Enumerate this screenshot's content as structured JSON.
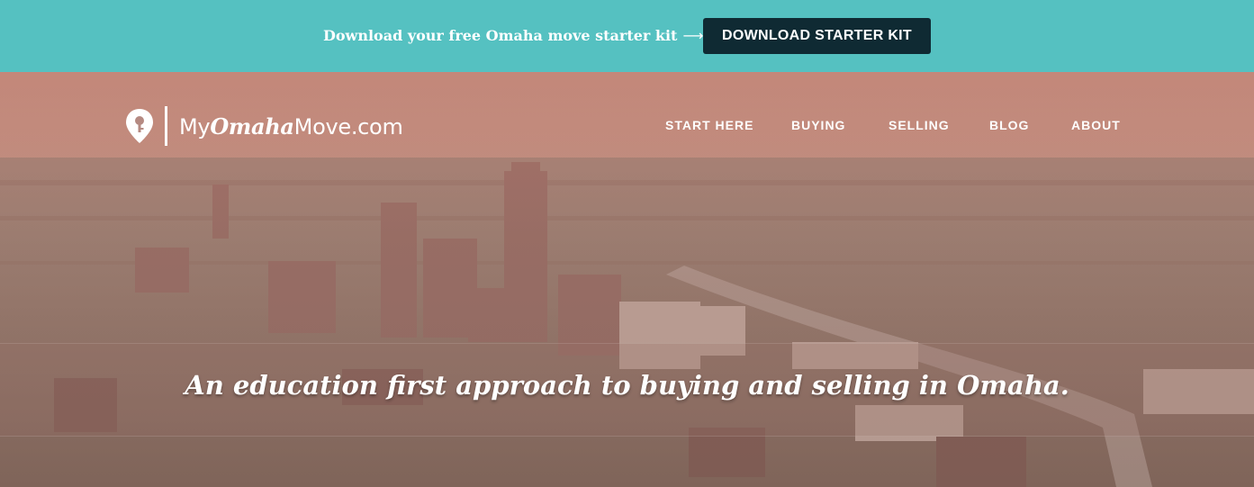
{
  "promo": {
    "text": "Download your free Omaha move starter kit",
    "arrow": "⟶",
    "button_label": "DOWNLOAD STARTER KIT"
  },
  "brand": {
    "prefix": "My",
    "accent": "Omaha",
    "suffix": "Move.com"
  },
  "nav": {
    "items": [
      {
        "label": "START HERE"
      },
      {
        "label": "BUYING"
      },
      {
        "label": "SELLING"
      },
      {
        "label": "BLOG"
      },
      {
        "label": "ABOUT"
      }
    ]
  },
  "hero": {
    "tagline": "An education first approach to buying and selling in Omaha."
  },
  "colors": {
    "topbar": "#55c1c1",
    "button": "#0f2a33"
  }
}
